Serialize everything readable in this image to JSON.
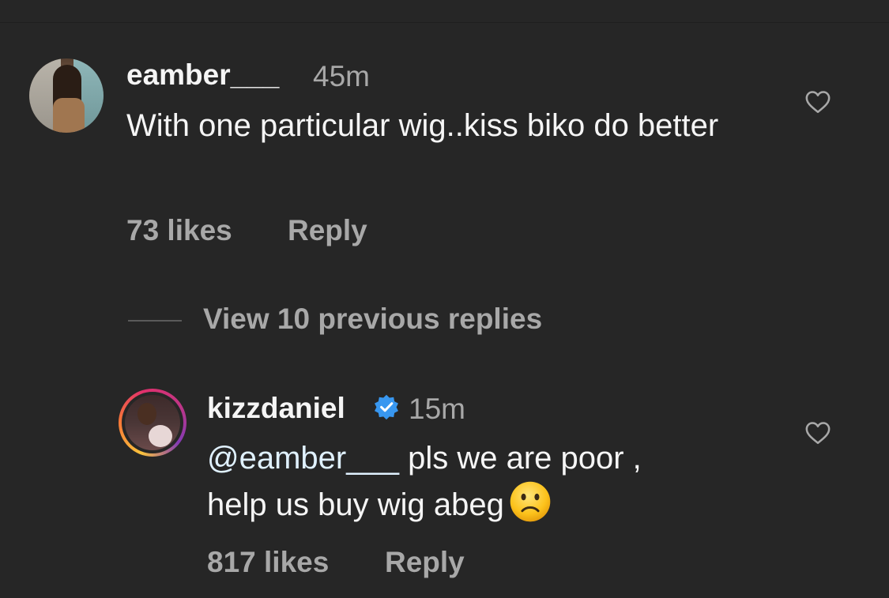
{
  "comment1": {
    "username": "eamber___",
    "time": "45m",
    "text": "With one particular wig..kiss biko do better",
    "likes": "73 likes",
    "reply_label": "Reply"
  },
  "view_replies_label": "View 10 previous replies",
  "comment2": {
    "username": "kizzdaniel",
    "verified": true,
    "time": "15m",
    "mention": "@eamber___",
    "text_line1": " pls we are poor ,",
    "text_line2": "help us buy wig abeg",
    "emoji": "slightly-frowning-face",
    "likes": "817 likes",
    "reply_label": "Reply"
  },
  "colors": {
    "background": "#262626",
    "primary_text": "#f5f5f5",
    "secondary_text": "#a8a8a8",
    "verified_blue": "#3897f0"
  },
  "icons": {
    "like": "heart-outline-icon",
    "verified": "verified-badge-icon"
  }
}
